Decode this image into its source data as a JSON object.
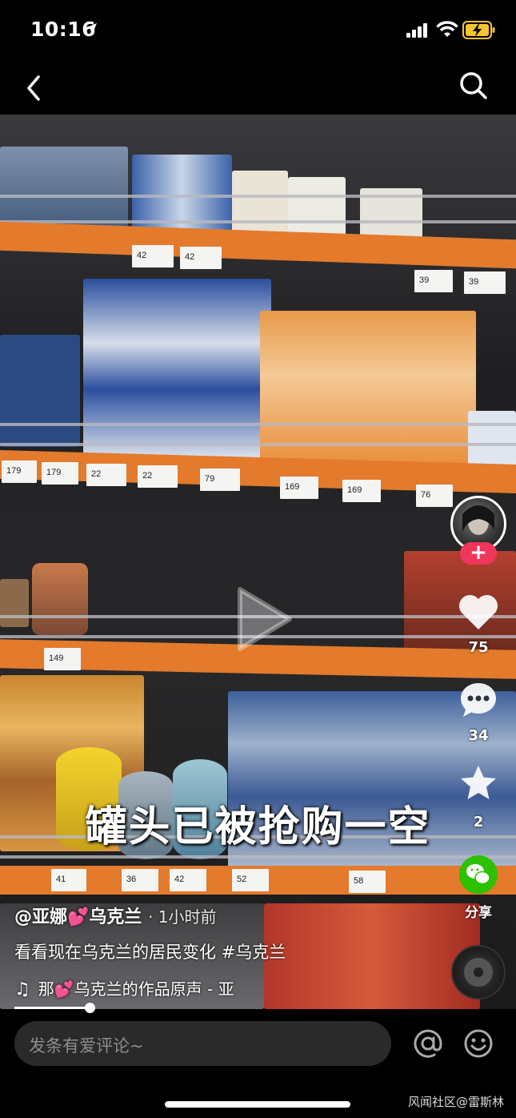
{
  "status_bar": {
    "time": "10:16"
  },
  "video": {
    "overlay_text": "罐头已被抢购一空",
    "price_tags": {
      "row1": [
        "42",
        "42",
        "39",
        "39"
      ],
      "row2": [
        "179",
        "179",
        "22",
        "22",
        "79",
        "169",
        "169",
        "76"
      ],
      "row3": [
        "149"
      ],
      "row4": [
        "41",
        "36",
        "42",
        "52",
        "58"
      ]
    }
  },
  "actions": {
    "like_count": "75",
    "comment_count": "34",
    "favorite_count": "2",
    "share_label": "分享"
  },
  "caption": {
    "author": "@亚娜💕乌克兰",
    "time_ago": "· 1小时前",
    "description": "看看现在乌克兰的居民变化 #乌克兰",
    "music": "那💕乌克兰的作品原声 - 亚"
  },
  "comment_bar": {
    "placeholder": "发条有爱评论~"
  },
  "watermark": "风闻社区@雷斯林",
  "colors": {
    "shelf": "#e37a2c",
    "like": "#f0365a",
    "wechat": "#2dc100"
  }
}
